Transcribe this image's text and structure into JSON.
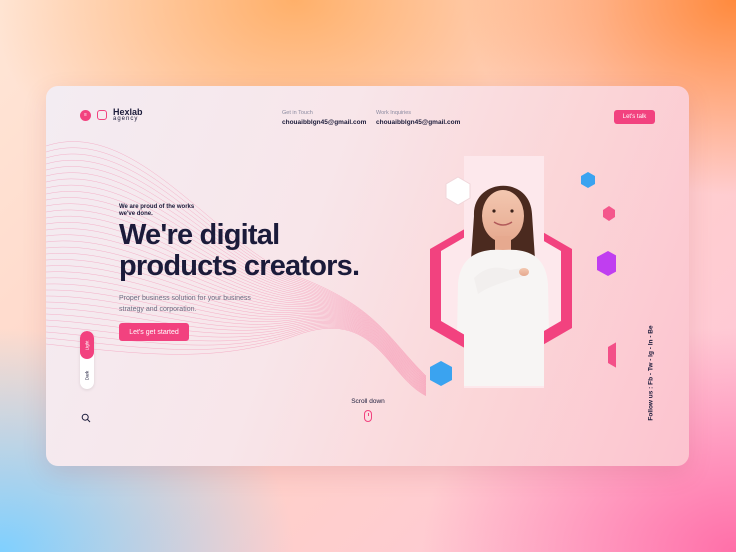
{
  "brand": {
    "name": "Hexlab",
    "tagline": "agency",
    "icon": "hexlab-logo-icon"
  },
  "header": {
    "contacts": [
      {
        "label": "Get in Touch",
        "value": "chouaibblgn45@gmail.com"
      },
      {
        "label": "Work Inquiries",
        "value": "chouaibblgn45@gmail.com"
      }
    ],
    "cta_label": "Let's talk"
  },
  "hero": {
    "kicker": "We are proud of the works we've done.",
    "headline_line1": "We're digital",
    "headline_line2": "products creators.",
    "description": "Proper business solution for your business strategy and corporation.",
    "button_label": "Let's get started"
  },
  "theme_toggle": {
    "light_label": "Light",
    "dark_label": "Dark",
    "selected": "Light"
  },
  "scroll_label": "Scroll down",
  "social_label": "Follow us : Fb - Tw - Ig - In - Be",
  "colors": {
    "accent": "#f2427f",
    "headline": "#1b1b3a",
    "hex_blue": "#3aa3f0",
    "hex_purple": "#c03ef0",
    "hex_pink": "#f2427f"
  },
  "icons": [
    "hexlab-logo-icon",
    "search-icon",
    "mouse-scroll-icon"
  ]
}
